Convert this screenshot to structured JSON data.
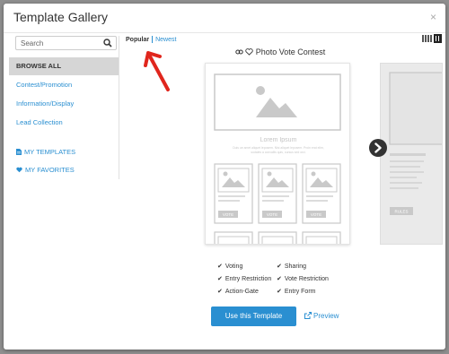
{
  "modal": {
    "title": "Template Gallery",
    "close_label": "×"
  },
  "search": {
    "placeholder": "Search"
  },
  "sidebar": {
    "items": [
      {
        "label": "BROWSE ALL",
        "active": true
      },
      {
        "label": "Contest/Promotion"
      },
      {
        "label": "Information/Display"
      },
      {
        "label": "Lead Collection"
      },
      {
        "label": "MY TEMPLATES",
        "icon": "document-icon"
      },
      {
        "label": "MY FAVORITES",
        "icon": "heart-icon"
      }
    ]
  },
  "sort": {
    "popular": "Popular",
    "newest": "Newest"
  },
  "template": {
    "name": "Photo Vote Contest",
    "preview_heading": "Lorem Ipsum",
    "preview_body_line1": "Duis ue amet aliquet leposem. Nisi aliquet leposem. Proin erat elim,",
    "preview_body_line2": "sodales a convallis quis, cursus sed orci.",
    "vote_label": "VOTE",
    "side_button": "RULES"
  },
  "features": {
    "col1": [
      "Voting",
      "Entry Restriction",
      "Action-Gate"
    ],
    "col2": [
      "Sharing",
      "Vote Restriction",
      "Entry Form"
    ]
  },
  "actions": {
    "use_label": "Use this Template",
    "preview_label": "Preview"
  },
  "colors": {
    "accent": "#2a8fd1",
    "annotation_arrow": "#e0261d"
  }
}
